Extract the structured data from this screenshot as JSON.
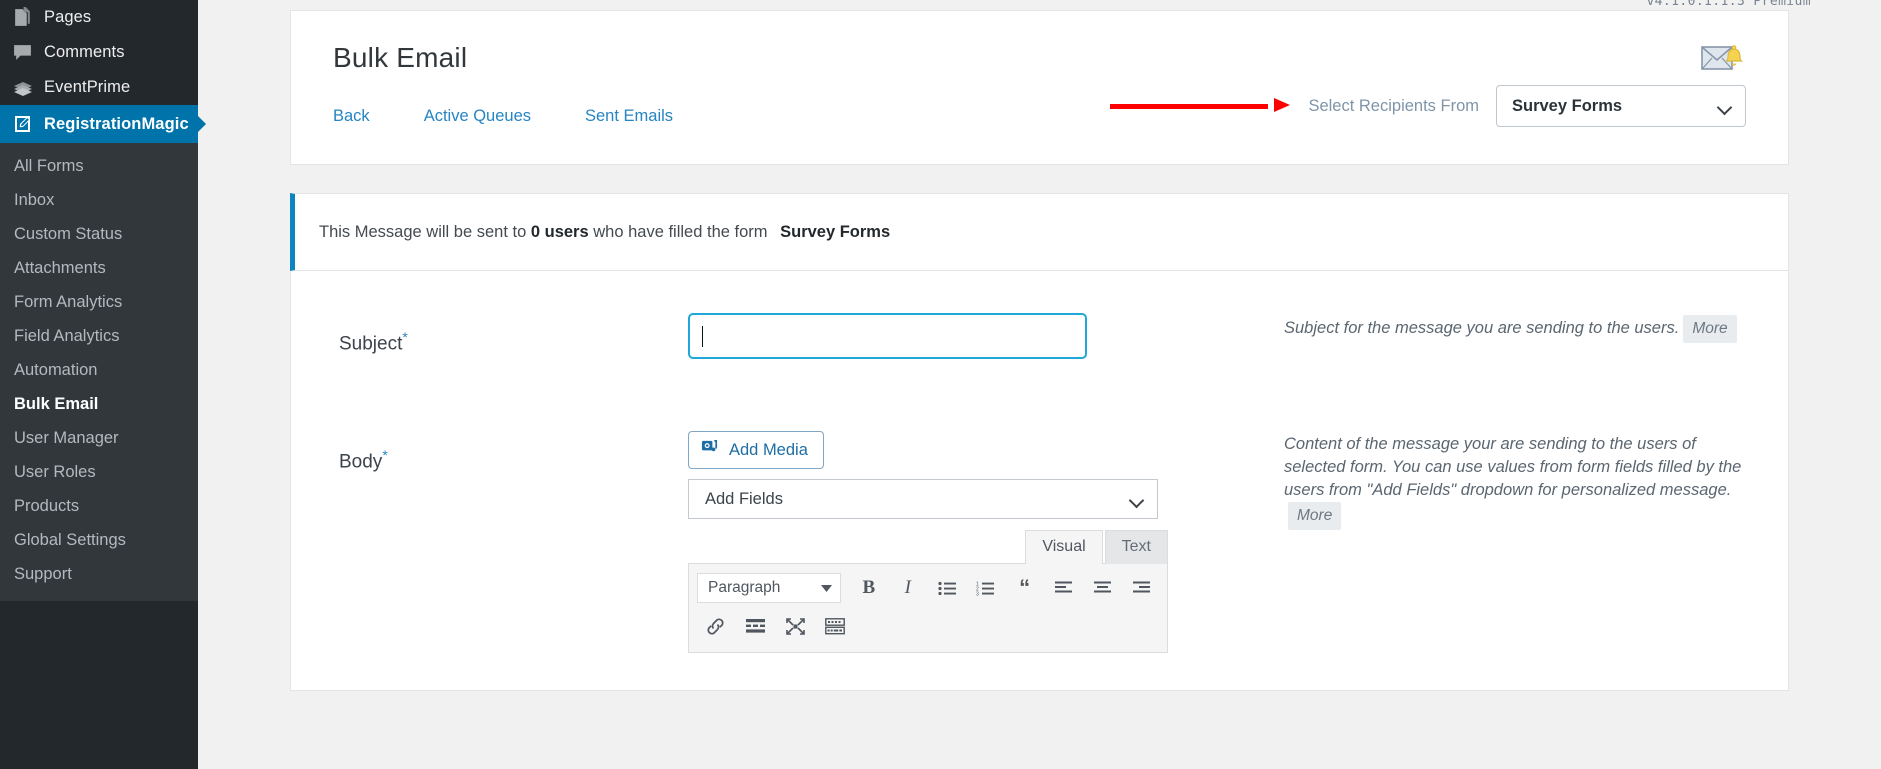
{
  "sidebar": {
    "top_items": [
      {
        "label": "Pages",
        "icon": "pages-icon",
        "current": false
      },
      {
        "label": "Comments",
        "icon": "comments-icon",
        "current": false
      },
      {
        "label": "EventPrime",
        "icon": "eventprime-icon",
        "current": false
      },
      {
        "label": "RegistrationMagic",
        "icon": "registrationmagic-icon",
        "current": true
      }
    ],
    "submenu": [
      {
        "label": "All Forms",
        "active": false
      },
      {
        "label": "Inbox",
        "active": false
      },
      {
        "label": "Custom Status",
        "active": false
      },
      {
        "label": "Attachments",
        "active": false
      },
      {
        "label": "Form Analytics",
        "active": false
      },
      {
        "label": "Field Analytics",
        "active": false
      },
      {
        "label": "Automation",
        "active": false
      },
      {
        "label": "Bulk Email",
        "active": true
      },
      {
        "label": "User Manager",
        "active": false
      },
      {
        "label": "User Roles",
        "active": false
      },
      {
        "label": "Products",
        "active": false
      },
      {
        "label": "Global Settings",
        "active": false
      },
      {
        "label": "Support",
        "active": false
      }
    ]
  },
  "version_label": "v4.1.0.1.1.3  Premium",
  "header": {
    "title": "Bulk Email",
    "nav_links": [
      {
        "label": "Back"
      },
      {
        "label": "Active Queues"
      },
      {
        "label": "Sent Emails"
      }
    ],
    "recipients_label": "Select Recipients From",
    "recipients_selected": "Survey Forms"
  },
  "notice": {
    "prefix": "This Message will be sent to",
    "count": "0 users",
    "middle": "who have filled the form",
    "form_name": "Survey Forms"
  },
  "subject": {
    "label": "Subject",
    "required_mark": "*",
    "value": "",
    "placeholder": "",
    "help": "Subject for the message you are sending to the users.",
    "more_label": "More"
  },
  "body": {
    "label": "Body",
    "required_mark": "*",
    "add_media_label": "Add Media",
    "add_fields_label": "Add Fields",
    "tabs": [
      {
        "label": "Visual",
        "active": true
      },
      {
        "label": "Text",
        "active": false
      }
    ],
    "toolbar": {
      "paragraph_label": "Paragraph",
      "row1": [
        {
          "name": "bold-icon",
          "glyph": "B"
        },
        {
          "name": "italic-icon",
          "glyph": "I"
        },
        {
          "name": "bulleted-list-icon",
          "glyph": ""
        },
        {
          "name": "numbered-list-icon",
          "glyph": ""
        },
        {
          "name": "blockquote-icon",
          "glyph": "“"
        },
        {
          "name": "align-left-icon",
          "glyph": ""
        },
        {
          "name": "align-center-icon",
          "glyph": ""
        },
        {
          "name": "align-right-icon",
          "glyph": ""
        }
      ],
      "row2": [
        {
          "name": "insert-link-icon"
        },
        {
          "name": "read-more-icon"
        },
        {
          "name": "fullscreen-icon"
        },
        {
          "name": "keyboard-shortcuts-icon"
        }
      ]
    },
    "help": "Content of the message your are sending to the users of selected form. You can use values from form fields filled by the users from \"Add Fields\" dropdown for personalized message.",
    "more_label": "More"
  },
  "colors": {
    "wp_sidebar": "#23282d",
    "wp_submenu": "#32373c",
    "wp_current": "#0073aa",
    "link_blue": "#2685c2",
    "notice_accent": "#0c84c0",
    "focus_border": "#1fa8d8",
    "annotation_red": "#ff0000"
  }
}
